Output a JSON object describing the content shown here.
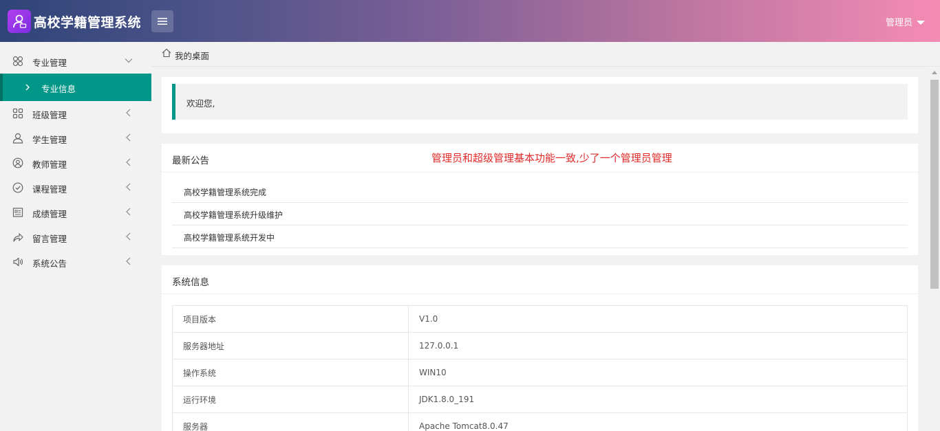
{
  "header": {
    "app_title": "高校学籍管理系统",
    "user_label": "管理员",
    "gradient_colors": [
      "#2f4478",
      "#f58cb4"
    ]
  },
  "sidebar": {
    "active_color": "#009688",
    "items": [
      {
        "label": "专业管理",
        "icon": "grid-flower-icon",
        "expanded": true
      },
      {
        "label": "班级管理",
        "icon": "grid-icon"
      },
      {
        "label": "学生管理",
        "icon": "user-icon"
      },
      {
        "label": "教师管理",
        "icon": "user-circle-icon"
      },
      {
        "label": "课程管理",
        "icon": "check-circle-icon"
      },
      {
        "label": "成绩管理",
        "icon": "report-icon"
      },
      {
        "label": "留言管理",
        "icon": "share-icon"
      },
      {
        "label": "系统公告",
        "icon": "speaker-icon"
      }
    ],
    "sub_item": {
      "label": "专业信息"
    }
  },
  "breadcrumb": {
    "label": "我的桌面"
  },
  "welcome": {
    "text": "欢迎您,"
  },
  "notice": {
    "title": "最新公告",
    "annotation": "管理员和超级管理基本功能一致,少了一个管理员管理",
    "items": [
      "高校学籍管理系统完成",
      "高校学籍管理系统升级维护",
      "高校学籍管理系统开发中"
    ]
  },
  "sysinfo": {
    "title": "系统信息",
    "rows": [
      {
        "key": "项目版本",
        "value": "V1.0"
      },
      {
        "key": "服务器地址",
        "value": "127.0.0.1"
      },
      {
        "key": "操作系统",
        "value": "WIN10"
      },
      {
        "key": "运行环境",
        "value": "JDK1.8.0_191"
      },
      {
        "key": "服务器",
        "value": "Apache Tomcat8.0.47"
      }
    ]
  }
}
